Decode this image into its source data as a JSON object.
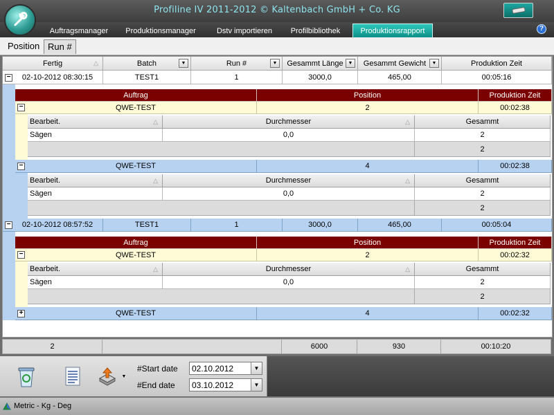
{
  "window": {
    "title": "Profiline IV 2011-2012 © Kaltenbach GmbH + Co. KG"
  },
  "tabs": [
    {
      "label": "Auftragsmanager"
    },
    {
      "label": "Produktionsmanager"
    },
    {
      "label": "Dstv importieren"
    },
    {
      "label": "Profilbibliothek"
    },
    {
      "label": "Produktionsrapport",
      "active": true
    }
  ],
  "subtabs": [
    {
      "label": "Position"
    },
    {
      "label": "Run #"
    }
  ],
  "grid": {
    "columns": [
      "Fertig",
      "Batch",
      "Run #",
      "Gesammt Länge",
      "Gesammt Gewicht",
      "Produktion Zeit"
    ],
    "detail_columns": [
      "Auftrag",
      "Position",
      "Produktion Zeit"
    ],
    "op_columns": [
      "Bearbeit.",
      "Durchmesser",
      "Gesammt"
    ],
    "runs": [
      {
        "fertig": "02-10-2012 08:30:15",
        "batch": "TEST1",
        "run": "1",
        "laenge": "3000,0",
        "gewicht": "465,00",
        "zeit": "00:05:16",
        "orders": [
          {
            "auftrag": "QWE-TEST",
            "position": "2",
            "zeit": "00:02:38",
            "op": {
              "bearbeit": "Sägen",
              "durchmesser": "0,0",
              "gesammt": "2"
            },
            "footer": "2"
          },
          {
            "auftrag": "QWE-TEST",
            "position": "4",
            "zeit": "00:02:38",
            "op": {
              "bearbeit": "Sägen",
              "durchmesser": "0,0",
              "gesammt": "2"
            },
            "footer": "2"
          }
        ]
      },
      {
        "fertig": "02-10-2012 08:57:52",
        "batch": "TEST1",
        "run": "1",
        "laenge": "3000,0",
        "gewicht": "465,00",
        "zeit": "00:05:04",
        "orders": [
          {
            "auftrag": "QWE-TEST",
            "position": "2",
            "zeit": "00:02:32",
            "op": {
              "bearbeit": "Sägen",
              "durchmesser": "0,0",
              "gesammt": "2"
            },
            "footer": "2"
          },
          {
            "auftrag": "QWE-TEST",
            "position": "4",
            "zeit": "00:02:32"
          }
        ]
      }
    ]
  },
  "summary": {
    "count": "2",
    "laenge": "6000",
    "gewicht": "930",
    "zeit": "00:10:20"
  },
  "toolbar": {
    "start_label": "#Start date",
    "start_value": "02.10.2012",
    "end_label": "#End date",
    "end_value": "03.10.2012"
  },
  "status": {
    "units": "Metric - Kg - Deg"
  },
  "icons": {
    "expand": "+",
    "collapse": "−",
    "sort": "△",
    "dropdown": "▼"
  },
  "colors": {
    "accent": "#1fb3aa",
    "detail_header": "#7b0000",
    "row_yellow": "#fffbd7",
    "row_blue": "#b6d2f0"
  }
}
